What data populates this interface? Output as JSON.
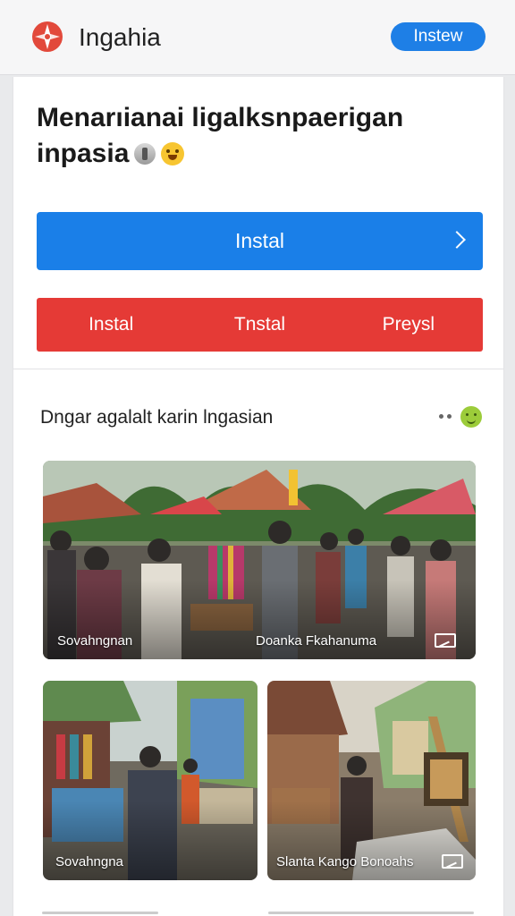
{
  "header": {
    "app_title": "Ingahia",
    "action_label": "Instew",
    "logo_icon": "compass-star-icon",
    "accent": "#1e7fe6"
  },
  "main": {
    "headline": "Menarıianai ligalksnpaerigan inpasia",
    "primary_button": "Instal",
    "primary_color": "#1a7fe8",
    "red_buttons": [
      "Instal",
      "Tnstal",
      "Preysl"
    ],
    "red_color": "#e53a36"
  },
  "gallery": {
    "label": "Dngar agalalt karin lngasian",
    "more_icon": "ellipsis-icon",
    "emoji_icon": "smiley-icon",
    "items": [
      {
        "caption_left": "Sovahngnan",
        "caption_right": "Doanka Fkahanuma",
        "icon": "frame-icon"
      },
      {
        "caption_left": "Sovahngna"
      },
      {
        "caption_left": "Slanta Kango Bonoahs",
        "icon": "frame-icon"
      }
    ]
  }
}
